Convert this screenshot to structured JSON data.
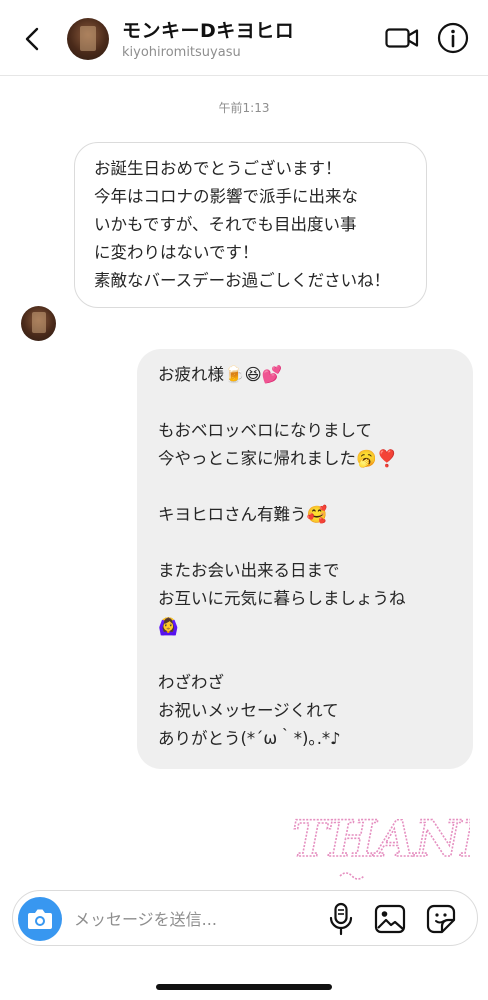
{
  "header": {
    "title": "モンキーDキヨヒロ",
    "username": "kiyohiromitsuyasu"
  },
  "conversation": {
    "timestamp": "午前1:13",
    "incoming_message": "お誕生日おめでとうございます！\n今年はコロナの影響で派手に出来な\nいかもですが、それでも目出度い事\nに変わりはないです！\n素敵なバースデーお過ごしくださいね！",
    "outgoing_message": "お疲れ様🍺😆💕\n\nもおベロッベロになりまして\n今やっとこ家に帰れました🥱❣️\n\nキヨヒロさん有難う🥰\n\nまたお会い出来る日まで\nお互いに元気に暮らしましょうね\n🙆‍♀️\n\nわざわざ\nお祝いメッセージくれて\nありがとう(*´ω｀*)｡.*♪",
    "sticker_text": "THANK"
  },
  "composer": {
    "placeholder": "メッセージを送信..."
  },
  "icons": {
    "back": "chevron-left-icon",
    "video": "video-camera-icon",
    "info": "info-icon",
    "camera": "camera-icon",
    "mic": "microphone-icon",
    "gallery": "image-gallery-icon",
    "sticker": "sticker-icon"
  },
  "colors": {
    "camera_button": "#3897f0",
    "outgoing_bubble": "#efefef",
    "sticker": "#e58fc0"
  }
}
